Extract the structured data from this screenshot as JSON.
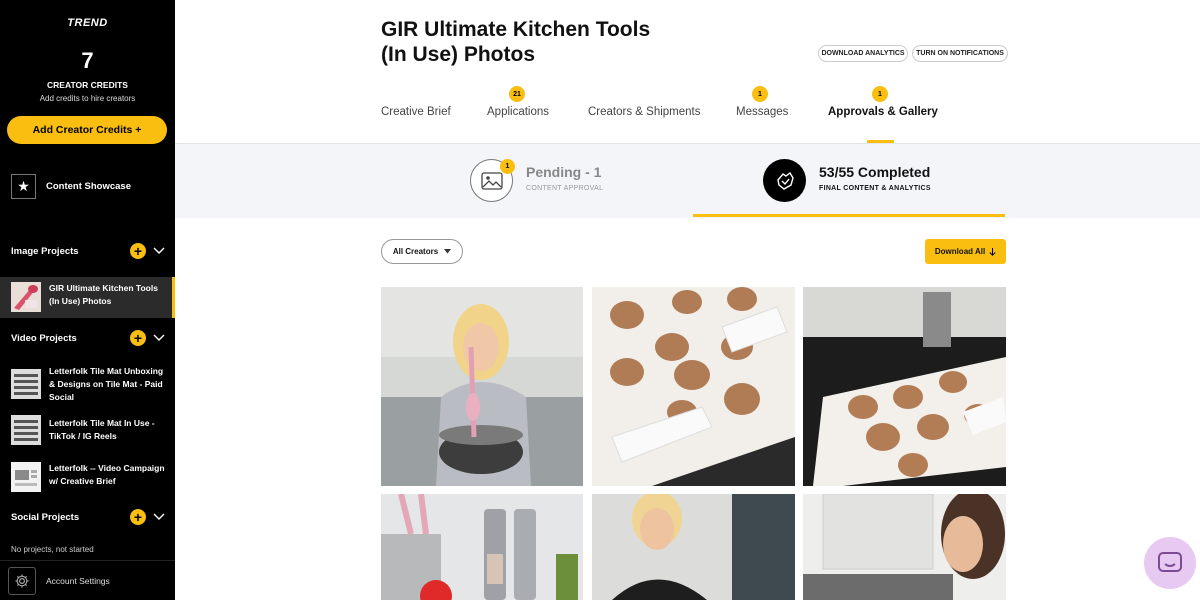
{
  "sidebar": {
    "logo": "TREND",
    "credits_count": "7",
    "credits_label": "CREATOR CREDITS",
    "credits_sub": "Add credits to hire creators",
    "add_credits_label": "Add Creator Credits +",
    "showcase_label": "Content Showcase",
    "image_projects_title": "Image Projects",
    "video_projects_title": "Video Projects",
    "social_projects_title": "Social Projects",
    "image_projects": [
      {
        "label": "GIR Ultimate Kitchen Tools (In Use) Photos"
      }
    ],
    "video_projects": [
      {
        "label": "Letterfolk Tile Mat Unboxing & Designs on Tile Mat - Paid Social"
      },
      {
        "label": "Letterfolk Tile Mat In Use - TikTok / IG Reels"
      },
      {
        "label": "Letterfolk -- Video Campaign w/ Creative Brief"
      }
    ],
    "no_projects": "No projects, not started",
    "account_settings": "Account Settings"
  },
  "header": {
    "title": "GIR Ultimate Kitchen Tools (In Use) Photos",
    "download_analytics": "DOWNLOAD ANALYTICS",
    "turn_on_notifications": "TURN ON NOTIFICATIONS"
  },
  "tabs": [
    {
      "label": "Creative Brief",
      "badge": ""
    },
    {
      "label": "Applications",
      "badge": "21"
    },
    {
      "label": "Creators & Shipments",
      "badge": ""
    },
    {
      "label": "Messages",
      "badge": "1"
    },
    {
      "label": "Approvals & Gallery",
      "badge": "1"
    }
  ],
  "status": {
    "pending_title": "Pending - 1",
    "pending_sub": "CONTENT APPROVAL",
    "pending_badge": "1",
    "completed_title": "53/55 Completed",
    "completed_sub": "FINAL CONTENT & ANALYTICS"
  },
  "filter_label": "All Creators",
  "download_all_label": "Download All",
  "colors": {
    "accent": "#F9BE0F",
    "sidebar_bg": "#000000",
    "band_bg": "#f3f5f8"
  }
}
